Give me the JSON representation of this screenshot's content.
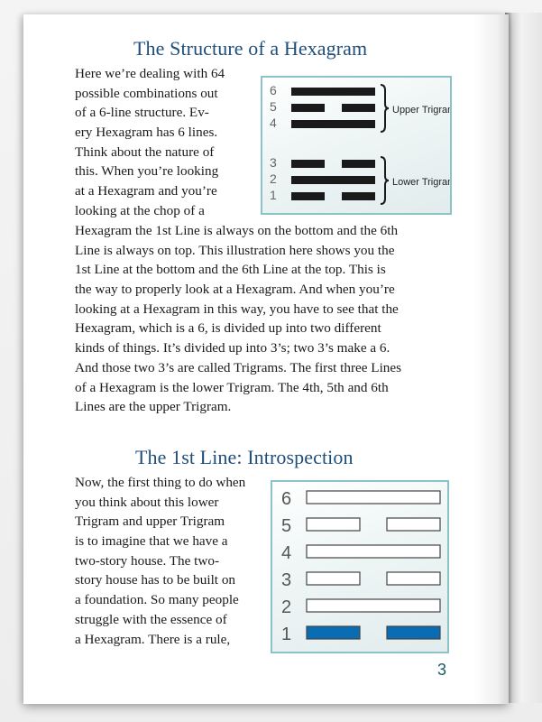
{
  "page": {
    "page_number": "3",
    "section1": {
      "title": "The Structure of a Hexagram",
      "wrapped_lines": [
        "Here we’re dealing with 64",
        "possible combinations out",
        "of a 6-line structure.  Ev-",
        "ery Hexagram has 6 lines.",
        "Think about the nature of",
        "this.  When you’re looking",
        "at a Hexagram and you’re",
        "looking at the chop of a"
      ],
      "full_lines": [
        "Hexagram the 1st Line is always on the bottom and the 6th",
        "Line is always on top.  This illustration here shows you the",
        "1st Line at the bottom and the 6th Line at the top.  This is",
        "the way to properly look at a Hexagram.  And when you’re",
        "looking at a Hexagram in this way, you have to see that the",
        "Hexagram, which is a 6, is divided up into two different",
        "kinds of things.  It’s divided up into 3’s; two 3’s make a 6.",
        "And those two 3’s are called Trigrams.  The first three Lines",
        "of a Hexagram is the lower Trigram.  The 4th, 5th and 6th",
        "Lines are the upper Trigram."
      ]
    },
    "diagram1": {
      "upper_label": "Upper Trigram",
      "lower_label": "Lower Trigram",
      "lines": [
        {
          "number": "6",
          "type": "solid"
        },
        {
          "number": "5",
          "type": "broken"
        },
        {
          "number": "4",
          "type": "solid"
        },
        {
          "number": "3",
          "type": "broken"
        },
        {
          "number": "2",
          "type": "solid"
        },
        {
          "number": "1",
          "type": "broken"
        }
      ],
      "line_color": "#1a1a1a",
      "border_color": "#8cc3c9"
    },
    "section2": {
      "title": "The 1st Line: Introspection",
      "lines": [
        "Now, the first thing to do when",
        "you think about this lower",
        "Trigram and upper Trigram",
        "is to imagine that we have a",
        "two-story house.  The two-",
        "story house has to be built on",
        "a foundation.  So many people",
        "struggle with the essence of",
        "a Hexagram.  There is a rule,"
      ]
    },
    "diagram2": {
      "lines": [
        {
          "number": "6",
          "type": "solid",
          "highlighted": false
        },
        {
          "number": "5",
          "type": "broken",
          "highlighted": false
        },
        {
          "number": "4",
          "type": "solid",
          "highlighted": false
        },
        {
          "number": "3",
          "type": "broken",
          "highlighted": false
        },
        {
          "number": "2",
          "type": "solid",
          "highlighted": false
        },
        {
          "number": "1",
          "type": "broken",
          "highlighted": true
        }
      ],
      "highlight_color": "#0a6cb3",
      "outline_color": "#444444"
    },
    "colors": {
      "heading": "#1f4e79",
      "page_number": "#1c5b63"
    }
  }
}
